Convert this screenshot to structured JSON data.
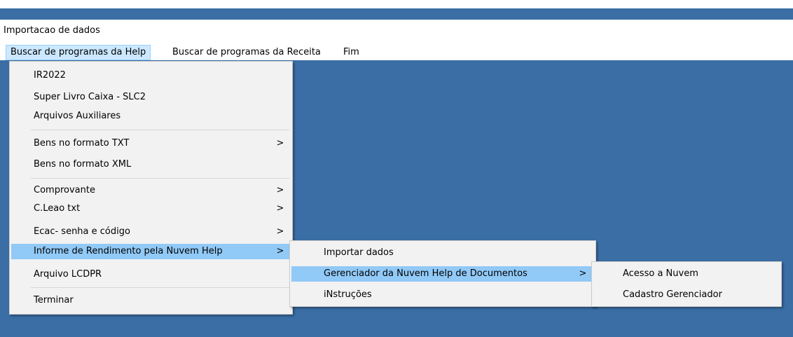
{
  "window": {
    "title": "Importacao de dados"
  },
  "menubar": {
    "items": [
      {
        "label": "Buscar de programas da Help"
      },
      {
        "label": "Buscar de programas da Receita"
      },
      {
        "label": "Fim"
      }
    ]
  },
  "menu1": {
    "items": [
      {
        "label": "IR2022"
      },
      {
        "label": "Super Livro Caixa - SLC2"
      },
      {
        "label": "Arquivos Auxiliares"
      },
      {
        "label": "Bens no formato TXT",
        "submenu_arrow": ">"
      },
      {
        "label": "Bens no formato XML"
      },
      {
        "label": "Comprovante",
        "submenu_arrow": ">"
      },
      {
        "label": "C.Leao txt",
        "submenu_arrow": ">"
      },
      {
        "label": "Ecac- senha e código",
        "submenu_arrow": ">"
      },
      {
        "label": "Informe de Rendimento pela Nuvem Help",
        "submenu_arrow": ">"
      },
      {
        "label": "Arquivo LCDPR"
      },
      {
        "label": "Terminar"
      }
    ]
  },
  "menu2": {
    "items": [
      {
        "label": "Importar dados"
      },
      {
        "label": "Gerenciador da Nuvem Help de Documentos",
        "submenu_arrow": ">"
      },
      {
        "label": "iNstruções"
      }
    ]
  },
  "menu3": {
    "items": [
      {
        "label": "Acesso a Nuvem"
      },
      {
        "label": "Cadastro Gerenciador"
      }
    ]
  },
  "colors": {
    "workspace": "#3a6ea5",
    "menu_background": "#f2f2f2",
    "highlight": "#91c9f7",
    "menubar_active": "#cce8ff"
  }
}
